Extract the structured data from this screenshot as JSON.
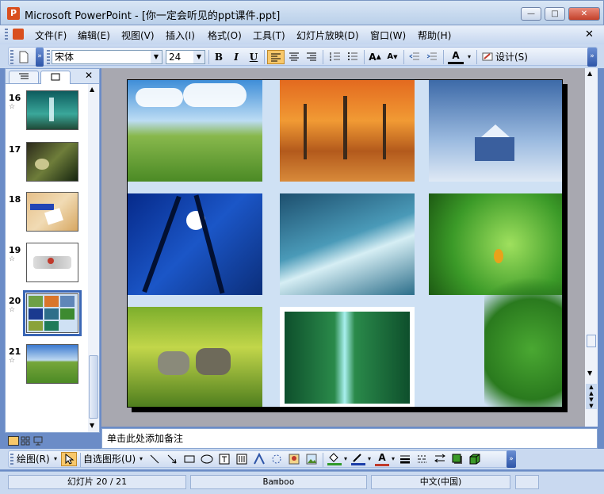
{
  "window": {
    "app_icon": "P",
    "title": "Microsoft PowerPoint - [你一定会听见的ppt课件.ppt]",
    "minimize": "—",
    "maximize": "□",
    "close": "✕"
  },
  "menu": {
    "items": [
      "文件(F)",
      "编辑(E)",
      "视图(V)",
      "插入(I)",
      "格式(O)",
      "工具(T)",
      "幻灯片放映(D)",
      "窗口(W)",
      "帮助(H)"
    ],
    "close_doc": "✕"
  },
  "toolbar": {
    "font_name": "宋体",
    "font_size": "24",
    "bold": "B",
    "italic": "I",
    "underline": "U",
    "design_label": "设计(S)"
  },
  "left_panel": {
    "tabs": [
      "outline-tab",
      "slides-tab"
    ],
    "close": "✕",
    "slides": [
      {
        "num": "16",
        "star": "☆"
      },
      {
        "num": "17",
        "star": ""
      },
      {
        "num": "18",
        "star": ""
      },
      {
        "num": "19",
        "star": "☆"
      },
      {
        "num": "20",
        "star": "☆"
      },
      {
        "num": "21",
        "star": "☆"
      }
    ],
    "selected_slide": "20"
  },
  "notes": {
    "placeholder": "单击此处添加备注"
  },
  "draw_toolbar": {
    "draw_label": "绘图(R)",
    "autoshapes_label": "自选图形(U)"
  },
  "status": {
    "slide_info": "幻灯片 20 / 21",
    "design": "Bamboo",
    "language": "中文(中国)"
  },
  "colors": {
    "chrome": "#c9d9f0",
    "selected_border": "#3a66b5",
    "accent_orange": "#f8c86a"
  }
}
